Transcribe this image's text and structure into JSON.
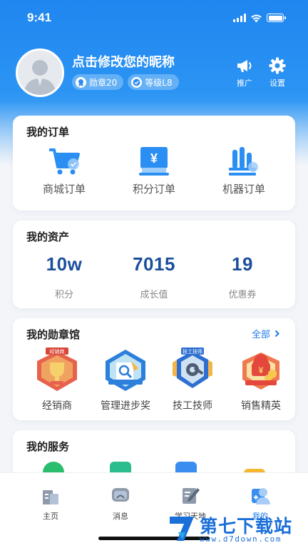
{
  "status_bar": {
    "time": "9:41",
    "icons": [
      "signal-icon",
      "wifi-icon",
      "battery-icon"
    ]
  },
  "profile": {
    "nickname": "点击修改您的昵称",
    "badges": [
      {
        "label": "勋章20",
        "icon": "medal-icon"
      },
      {
        "label": "等级L8",
        "icon": "level-check-icon"
      }
    ],
    "actions": [
      {
        "label": "推广",
        "icon": "megaphone-icon"
      },
      {
        "label": "设置",
        "icon": "gear-icon"
      }
    ]
  },
  "orders": {
    "title": "我的订单",
    "items": [
      {
        "label": "商城订单",
        "icon": "cart-icon"
      },
      {
        "label": "积分订单",
        "icon": "yen-points-icon"
      },
      {
        "label": "机器订单",
        "icon": "machine-icon"
      }
    ]
  },
  "assets": {
    "title": "我的资产",
    "items": [
      {
        "value": "10w",
        "label": "积分"
      },
      {
        "value": "7015",
        "label": "成长值"
      },
      {
        "value": "19",
        "label": "优惠券"
      }
    ]
  },
  "medals": {
    "title": "我的勋章馆",
    "all_label": "全部",
    "items": [
      {
        "label": "经销商",
        "icon": "trophy-medal-icon",
        "ribbon": "经销商"
      },
      {
        "label": "管理进步奖",
        "icon": "management-medal-icon"
      },
      {
        "label": "技工技师",
        "icon": "technician-medal-icon",
        "ribbon": "技工技师"
      },
      {
        "label": "销售精英",
        "icon": "sales-medal-icon"
      }
    ]
  },
  "services": {
    "title": "我的服务",
    "icons": [
      "service-green-icon",
      "service-heart-icon",
      "service-list-icon",
      "service-folder-icon"
    ]
  },
  "tabbar": {
    "items": [
      {
        "label": "主页",
        "icon": "home-building-icon",
        "active": false
      },
      {
        "label": "消息",
        "icon": "message-icon",
        "active": false
      },
      {
        "label": "学习天地",
        "icon": "learning-icon",
        "active": false
      },
      {
        "label": "我的",
        "icon": "profile-icon",
        "active": true
      }
    ]
  },
  "watermark": {
    "text": "第七下载站",
    "url": "www.d7down.com"
  },
  "colors": {
    "primary": "#1f7ae8",
    "asset_value": "#1b4f9c",
    "hero_top": "#1f86f0"
  }
}
